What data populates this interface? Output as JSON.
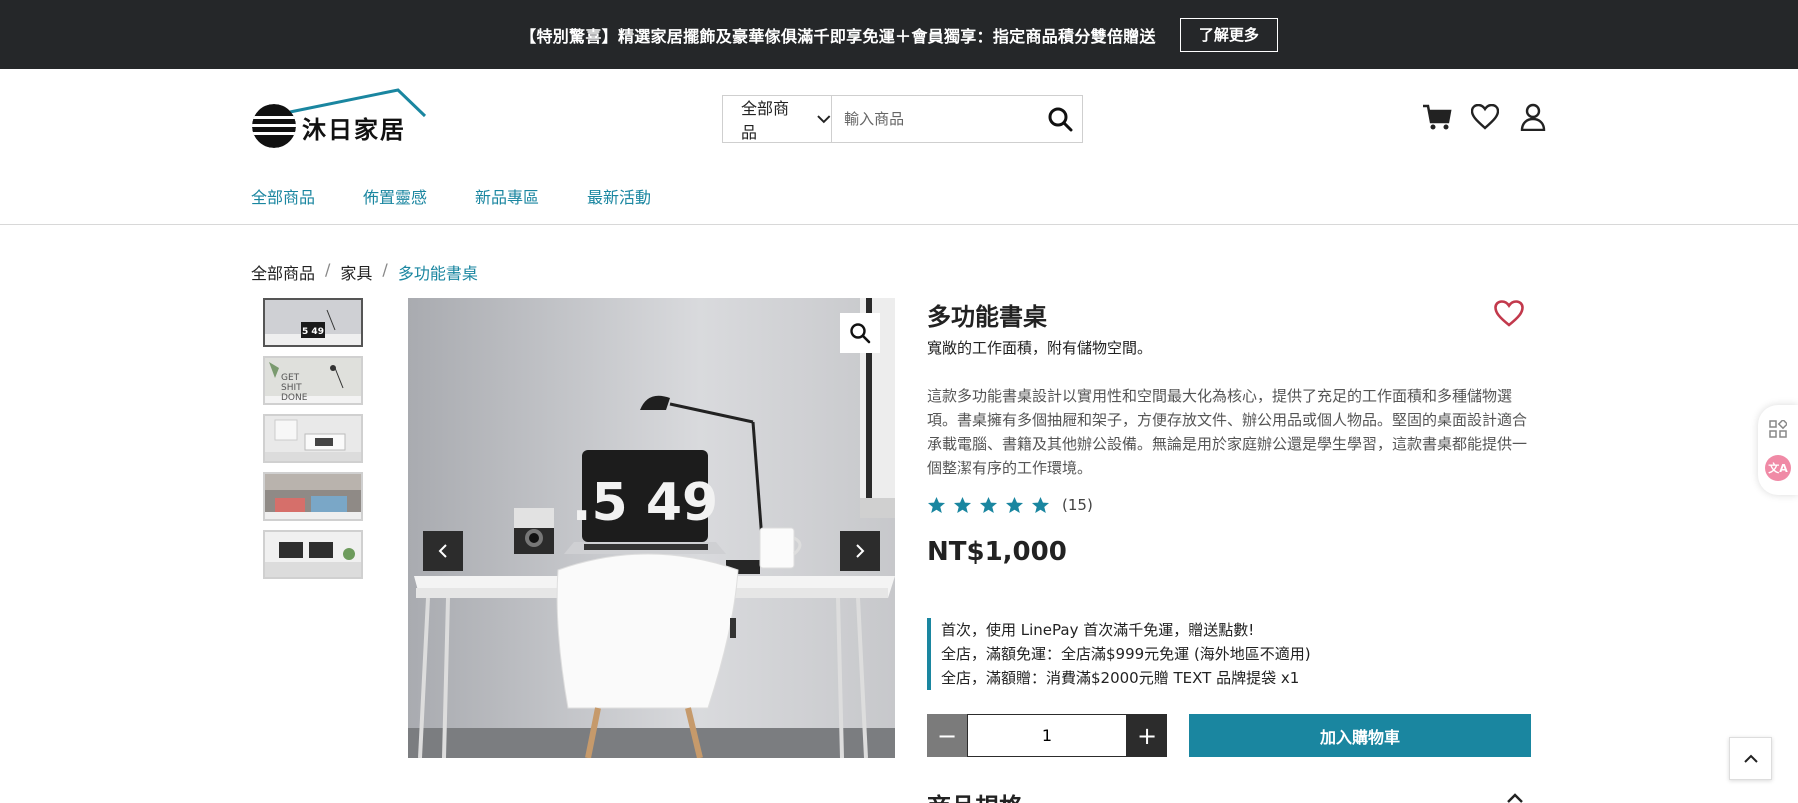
{
  "announcement": {
    "text": "【特別驚喜】精選家居擺飾及豪華傢俱滿千即享免運＋會員獨享：指定商品積分雙倍贈送",
    "button": "了解更多"
  },
  "brand": {
    "name": "沐日家居",
    "accent": "#1a86a0"
  },
  "search": {
    "category": "全部商品",
    "placeholder": "輸入商品"
  },
  "header_icons": [
    "cart-icon",
    "heart-icon",
    "user-icon"
  ],
  "nav": {
    "items": [
      "全部商品",
      "佈置靈感",
      "新品專區",
      "最新活動"
    ]
  },
  "breadcrumb": {
    "items": [
      "全部商品",
      "家具"
    ],
    "separator": "/",
    "current": "多功能書桌"
  },
  "gallery": {
    "main_clock": ".5 49",
    "thumb_clock": "5 49",
    "thumb_poster": "GET SHIT DONE"
  },
  "product": {
    "title": "多功能書桌",
    "subtitle": "寬敞的工作面積，附有儲物空間。",
    "description": "這款多功能書桌設計以實用性和空間最大化為核心，提供了充足的工作面積和多種儲物選項。書桌擁有多個抽屜和架子，方便存放文件、辦公用品或個人物品。堅固的桌面設計適合承載電腦、書籍及其他辦公設備。無論是用於家庭辦公還是學生學習，這款書桌都能提供一個整潔有序的工作環境。",
    "rating": 5,
    "review_count": "(15)",
    "price": "NT$1,000",
    "promotions": [
      "首次，使用 LinePay 首次滿千免運，贈送點數!",
      "全店，滿額免運：全店滿$999元免運 (海外地區不適用)",
      "全店，滿額贈：消費滿$2000元贈 TEXT 品牌提袋 x1"
    ],
    "quantity": "1",
    "minus": "−",
    "plus": "+",
    "add_to_cart": "加入購物車",
    "spec_heading": "商品規格"
  },
  "side": {
    "translate_label": "文A"
  }
}
